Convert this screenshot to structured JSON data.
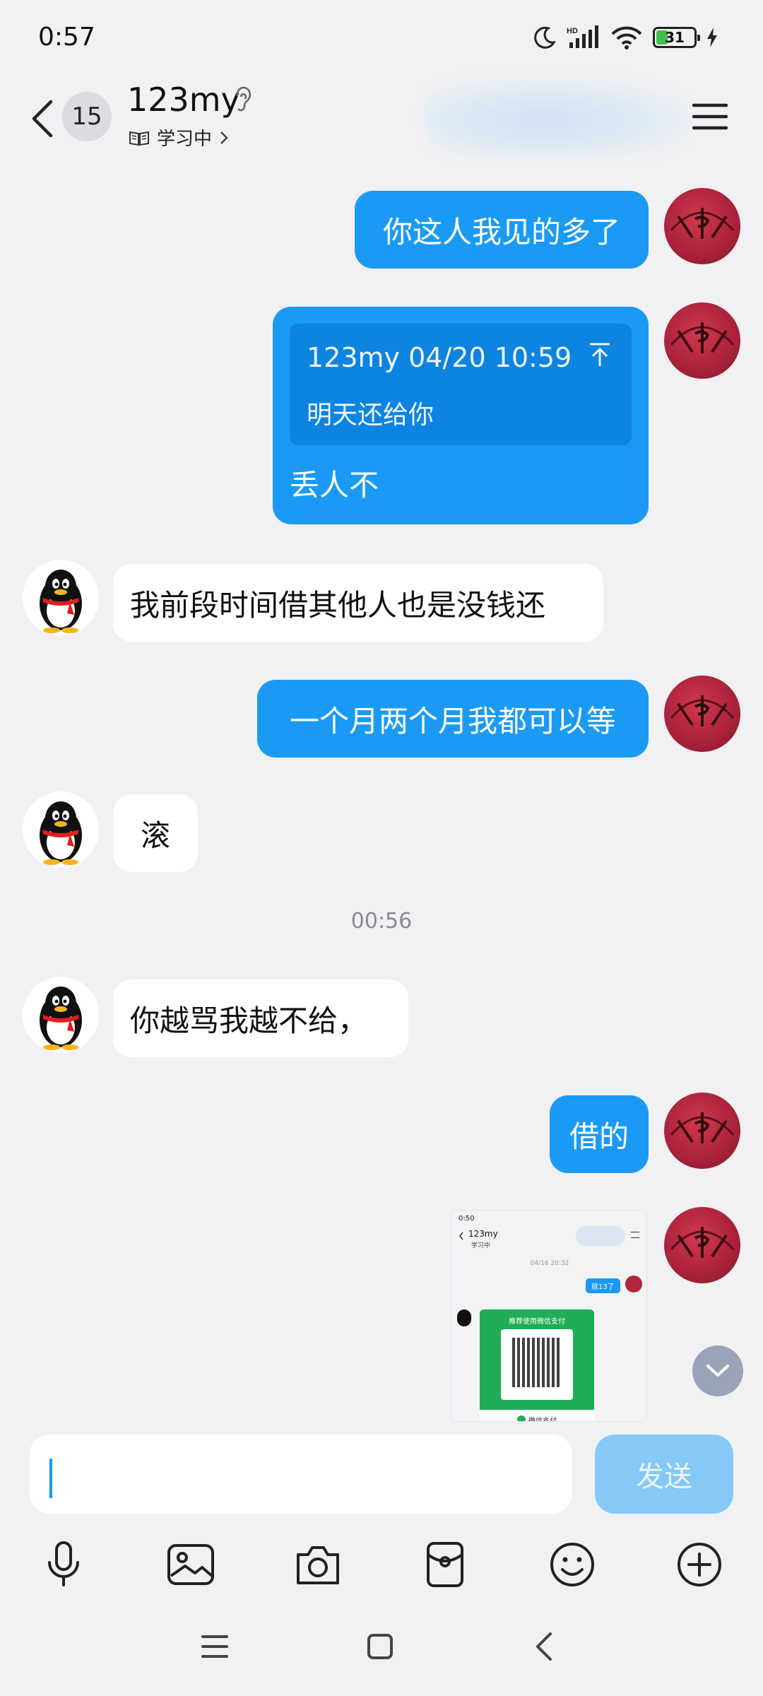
{
  "status_bar": {
    "time": "0:57",
    "battery_level": "31"
  },
  "header": {
    "unread_count": "15",
    "contact_name": "123my",
    "status_label": "学习中"
  },
  "messages": [
    {
      "from": "me",
      "text": "你这人我见的多了"
    },
    {
      "from": "me",
      "quote_header": "123my 04/20 10:59",
      "quote_text": "明天还给你",
      "text": "丢人不"
    },
    {
      "from": "other",
      "text": "我前段时间借其他人也是没钱还"
    },
    {
      "from": "me",
      "text": "一个月两个月我都可以等"
    },
    {
      "from": "other",
      "text": "滚"
    },
    {
      "timestamp": "00:56"
    },
    {
      "from": "other",
      "text": "你越骂我越不给，"
    },
    {
      "from": "me",
      "text": "借的"
    },
    {
      "from": "me",
      "image": "screenshot-image"
    }
  ],
  "thumbnail": {
    "time": "0:50",
    "name": "123my",
    "status": "学习中",
    "date": "04/16 20:32",
    "bubble": "就13了",
    "card_title": "推荐使用微信支付",
    "card_sub": "微信支付"
  },
  "input": {
    "placeholder": "",
    "send_label": "发送"
  },
  "colors": {
    "my_bubble": "#1a9af5",
    "other_bubble": "#ffffff",
    "background": "#f1f1f3",
    "send_disabled": "#86c8f7"
  },
  "toolbar_icons": [
    "microphone-icon",
    "image-icon",
    "camera-icon",
    "red-packet-icon",
    "emoji-icon",
    "plus-icon"
  ]
}
